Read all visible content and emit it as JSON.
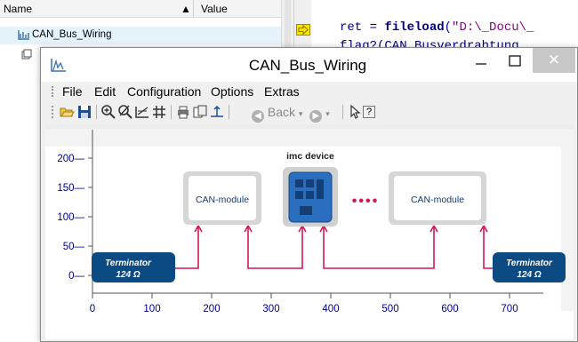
{
  "tree": {
    "header_name": "Name",
    "header_sort": "▲",
    "header_value": "Value",
    "row1_label": "CAN_Bus_Wiring"
  },
  "editor": {
    "line1_prefix": "ret = ",
    "line1_func": "fileload",
    "line1_open": "(",
    "line1_string": "\"D:\\_Docu\\_",
    "line2": "flag?(CAN_Busverdrahtung"
  },
  "window": {
    "title": "CAN_Bus_Wiring",
    "close_glyph": "✕",
    "menu": [
      "File",
      "Edit",
      "Configuration",
      "Options",
      "Extras"
    ],
    "toolbar": {
      "back_label": "Back",
      "help_label": "?"
    }
  },
  "diagram": {
    "device_label": "imc device",
    "module_left": "CAN-module",
    "module_right": "CAN-module",
    "dots": "••••",
    "term_left": [
      "Terminator",
      "124 Ω"
    ],
    "term_right": [
      "Terminator",
      "124 Ω"
    ],
    "y_ticks": [
      200,
      150,
      100,
      50,
      0
    ],
    "x_ticks": [
      0,
      100,
      200,
      300,
      400,
      500,
      600,
      700
    ],
    "colors": {
      "bus_line": "#d6155a",
      "terminator": "#0c4a83",
      "device": "#2a6fbf",
      "axis_text": "#00008b"
    }
  }
}
